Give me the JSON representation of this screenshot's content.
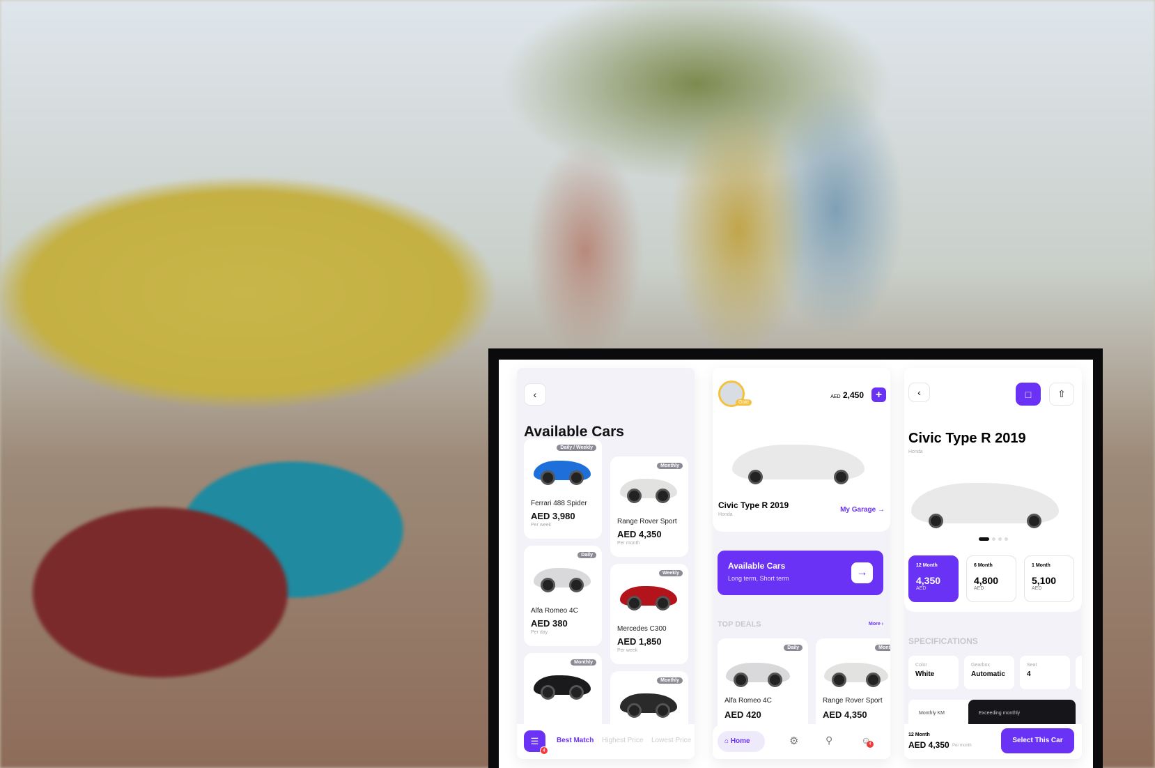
{
  "screen1": {
    "title": "Available Cars",
    "cards": [
      {
        "tag": "Daily / Weekly",
        "name": "Ferrari 488 Spider",
        "price": "AED 3,980",
        "period": "Per week",
        "color": "#1e6fd9"
      },
      {
        "tag": "Daily",
        "name": "Alfa Romeo 4C",
        "price": "AED 380",
        "period": "Per day",
        "color": "#d9d9db"
      },
      {
        "tag": "Monthly",
        "name": "",
        "price": "",
        "period": "",
        "color": "#1a1a1c"
      },
      {
        "tag": "Monthly",
        "name": "Range Rover Sport",
        "price": "AED 4,350",
        "period": "Per month",
        "color": "#e2e3e0"
      },
      {
        "tag": "Weekly",
        "name": "Mercedes C300",
        "price": "AED 1,850",
        "period": "Per week",
        "color": "#b3141c"
      },
      {
        "tag": "Monthly",
        "name": "",
        "price": "",
        "period": "",
        "color": "#2a2a2a"
      }
    ],
    "filter_badge": "4",
    "sort_tabs": [
      "Best Match",
      "Highest Price",
      "Lowest Price"
    ]
  },
  "screen2": {
    "avatar_badge": "Gold",
    "balance_currency": "AED",
    "balance": "2,450",
    "car_name": "Civic Type R 2019",
    "car_brand": "Honda",
    "garage_link": "My Garage",
    "banner_title": "Available Cars",
    "banner_subtitle": "Long term, Short term",
    "deals_title": "TOP DEALS",
    "more_link": "More",
    "deals": [
      {
        "tag": "Daily",
        "name": "Alfa Romeo 4C",
        "price": "AED 420",
        "color": "#d9d9db"
      },
      {
        "tag": "Monthly",
        "name": "Range Rover Sport",
        "price": "AED 4,350",
        "color": "#e2e3e0"
      }
    ],
    "nav": {
      "home": "Home",
      "profile_badge": "4"
    }
  },
  "screen3": {
    "title": "Civic Type R 2019",
    "brand": "Honda",
    "carousel": {
      "count": 4,
      "active": 0
    },
    "plans": [
      {
        "months": "12 Month",
        "price": "4,350",
        "currency": "AED",
        "selected": true
      },
      {
        "months": "6 Month",
        "price": "4,800",
        "currency": "AED",
        "selected": false
      },
      {
        "months": "1 Month",
        "price": "5,100",
        "currency": "AED",
        "selected": false
      }
    ],
    "spec_title": "SPECIFICATIONS",
    "specs": [
      {
        "label": "Color",
        "value": "White"
      },
      {
        "label": "Gearbox",
        "value": "Automatic"
      },
      {
        "label": "Seat",
        "value": "4"
      }
    ],
    "monthly_km_label": "Monthly KM",
    "exceeding_label": "Exceeding monthly",
    "footer": {
      "plan": "12 Month",
      "price": "AED 4,350",
      "period": "Per month",
      "cta": "Select This Car"
    }
  },
  "colors": {
    "accent": "#6a32f5",
    "gold": "#f5c03a",
    "alert": "#f03b3b"
  }
}
